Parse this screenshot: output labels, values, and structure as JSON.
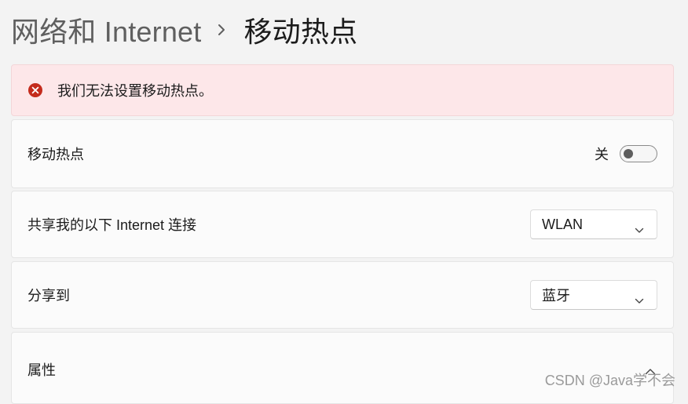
{
  "breadcrumb": {
    "parent": "网络和 Internet",
    "separator_icon": "chevron-right-icon",
    "current": "移动热点"
  },
  "error": {
    "icon": "error-circle-icon",
    "icon_color": "#c42b1c",
    "background": "#fde7e9",
    "message": "我们无法设置移动热点。"
  },
  "hotspot": {
    "label": "移动热点",
    "state_label": "关",
    "enabled": false
  },
  "share_connection": {
    "label": "共享我的以下 Internet 连接",
    "selected": "WLAN",
    "icon": "chevron-down-icon"
  },
  "share_to": {
    "label": "分享到",
    "selected": "蓝牙",
    "icon": "chevron-down-icon"
  },
  "properties": {
    "label": "属性",
    "icon": "chevron-up-icon"
  },
  "watermark": "CSDN @Java学不会"
}
